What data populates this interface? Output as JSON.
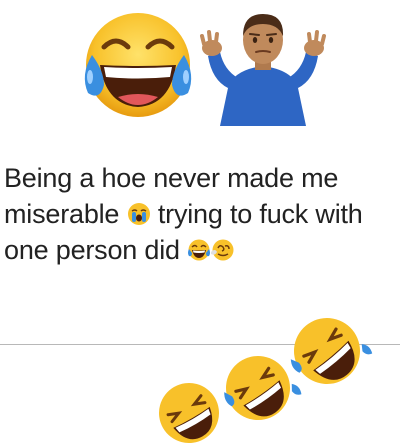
{
  "post": {
    "lines": [
      {
        "before": "Being a hoe never made me",
        "emoji": "",
        "after": ""
      },
      {
        "before": "miserable ",
        "emoji": "crying-face-icon",
        "after": " trying to fuck with"
      },
      {
        "before": "one person did ",
        "emoji": "laughing-tears-icon",
        "after": ""
      }
    ],
    "trailing_emoji": "swirl-face-icon"
  },
  "top_emojis": [
    "face-with-tears-of-joy-icon",
    "man-shrugging-icon"
  ],
  "bottom_emojis": [
    "rolling-on-floor-laughing-icon",
    "rolling-on-floor-laughing-icon",
    "rolling-on-floor-laughing-icon"
  ],
  "colors": {
    "text": "#222222",
    "emoji_yellow": "#f8c12a",
    "tear_blue": "#3a8fe0",
    "shirt_blue": "#2e66c4",
    "divider": "#b8b8b8"
  }
}
